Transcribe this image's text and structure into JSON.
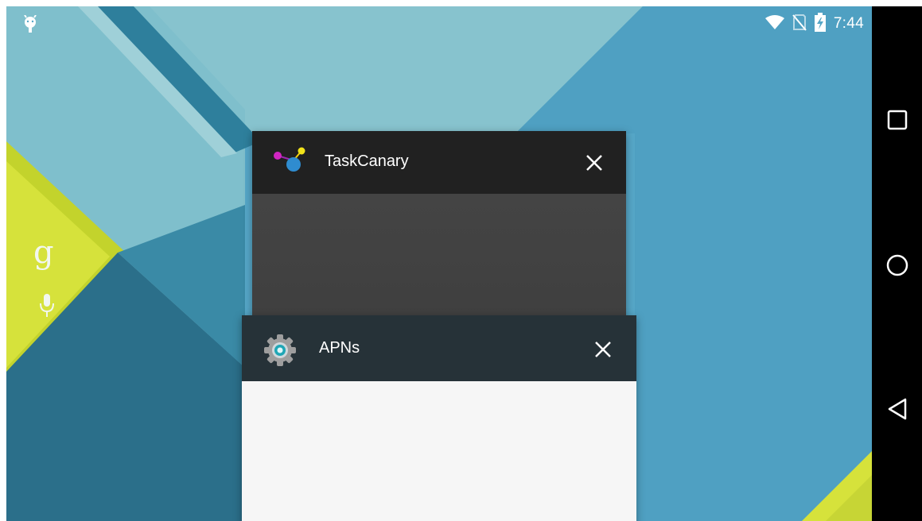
{
  "status_bar": {
    "time": "7:44",
    "icons": [
      "android-notification-icon",
      "wifi-icon",
      "no-sim-icon",
      "battery-charging-icon"
    ]
  },
  "search_widget": {
    "google_letter": "g",
    "icons": [
      "google-search-icon",
      "microphone-icon"
    ]
  },
  "recents": {
    "cards": [
      {
        "title": "TaskCanary",
        "icon": "taskcanary-app-icon",
        "header_color": "#212121",
        "preview_color": "#3d3d3d"
      },
      {
        "title": "APNs",
        "icon": "settings-gear-icon",
        "header_color": "#263238",
        "preview_color": "#f5f5f5"
      }
    ]
  },
  "nav_bar": {
    "buttons": [
      "recents-button",
      "home-button",
      "back-button"
    ]
  },
  "colors": {
    "wallpaper_blue": "#55a6c6",
    "wallpaper_teal": "#2d7f98",
    "wallpaper_light": "#8ec8d2",
    "wallpaper_yellow": "#d4e33a"
  }
}
